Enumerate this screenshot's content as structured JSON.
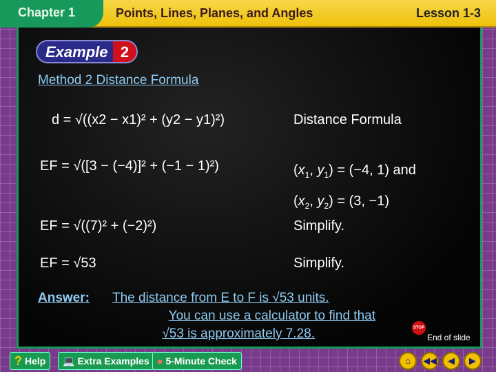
{
  "header": {
    "chapter": "Chapter 1",
    "title": "Points, Lines, Planes, and Angles",
    "lesson": "Lesson 1-3"
  },
  "example": {
    "label": "Example",
    "number": "2"
  },
  "method": "Method 2  Distance Formula",
  "steps": [
    {
      "formula": "d = √((x2 − x1)² + (y2 − y1)²)",
      "note": "Distance Formula"
    },
    {
      "formula": "EF = √([3 − (−4)]² + (−1 − 1)²)",
      "note": "(x1, y1) = (−4, 1) and (x2, y2) = (3, −1)"
    },
    {
      "formula": "EF = √((7)² + (−2)²)",
      "note": "Simplify."
    },
    {
      "formula": "EF = √53",
      "note": "Simplify."
    }
  ],
  "answer": {
    "label": "Answer:",
    "line1": "The distance from E to F is √53 units.",
    "line2": "You can use a calculator to find that",
    "line3": "√53 is approximately 7.28."
  },
  "end_of_slide": "End of slide",
  "stop_sign": "STOP",
  "bottom": {
    "help": "Help",
    "extra": "Extra Examples",
    "check": "5-Minute Check"
  },
  "nav": [
    "home-icon",
    "rewind-icon",
    "back-icon",
    "forward-icon"
  ]
}
